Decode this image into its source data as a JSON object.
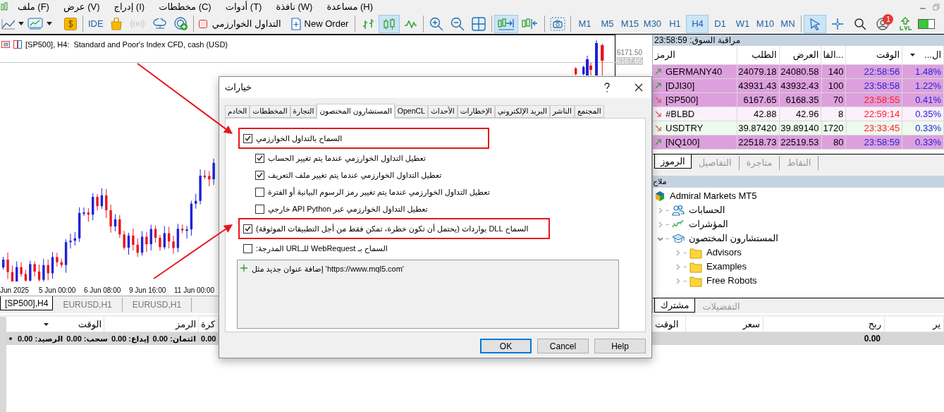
{
  "menu": [
    {
      "label": "مساعدة (H)"
    },
    {
      "label": "نافذة (W)"
    },
    {
      "label": "أدوات (T)"
    },
    {
      "label": "مخططات (C)"
    },
    {
      "label": "إدراج (I)"
    },
    {
      "label": "عرض (V)"
    },
    {
      "label": "ملف (F)"
    }
  ],
  "toolbar": {
    "ide": "IDE",
    "algo_trading": "التداول الخوارزمي",
    "new_order": "New Order",
    "chart_modes": [
      {
        "kind": "line",
        "selected": false
      },
      {
        "kind": "candles",
        "selected": true
      },
      {
        "kind": "bars",
        "selected": false
      }
    ],
    "scroll_modes": [
      {
        "kind": "shift",
        "selected": false
      },
      {
        "kind": "autoscroll",
        "selected": true
      }
    ],
    "timeframes": [
      {
        "label": "MN",
        "selected": false
      },
      {
        "label": "M10",
        "selected": false
      },
      {
        "label": "W1",
        "selected": false
      },
      {
        "label": "D1",
        "selected": false
      },
      {
        "label": "H4",
        "selected": true
      },
      {
        "label": "H1",
        "selected": false
      },
      {
        "label": "M30",
        "selected": false
      },
      {
        "label": "M15",
        "selected": false
      },
      {
        "label": "M5",
        "selected": false
      },
      {
        "label": "M1",
        "selected": false
      }
    ],
    "pointer_tools": [
      {
        "kind": "crosshair",
        "selected": false
      },
      {
        "kind": "cursor",
        "selected": true
      }
    ],
    "notification_count": "1"
  },
  "chart": {
    "title": "[SP500], H4:  Standard and Poor's Index CFD, cash (USD)",
    "price_labels": [
      {
        "label": "6171.50",
        "selected": false
      },
      {
        "label": "6167.65",
        "selected": true
      }
    ],
    "x_labels": [
      "11 Jun 00:00",
      "9 Jun 16:00",
      "6 Jun 08:00",
      "5 Jun 00:00",
      "Jun 2025"
    ],
    "tabs": [
      {
        "label": "EURUSD,H1",
        "selected": false
      },
      {
        "label": "EURUSD,H1",
        "selected": false
      },
      {
        "label": "[SP500],H4",
        "selected": true
      }
    ]
  },
  "market_watch": {
    "title": "مراقبة السوق: 23:58:59",
    "columns": [
      "...ال",
      "الوقت",
      "الفا...",
      "العرض",
      "الطلب",
      "الرمز"
    ],
    "rows": [
      {
        "symbol": "GERMANY40",
        "bid": "24079.18",
        "ask": "24080.58",
        "spread": "140",
        "time": "22:58:56",
        "change": "1.48%",
        "rising": true,
        "color": "#dda0dd"
      },
      {
        "symbol": "[DJI30]",
        "bid": "43931.43",
        "ask": "43932.43",
        "spread": "100",
        "time": "23:58:58",
        "change": "1.22%",
        "rising": true,
        "color": "#dda0dd"
      },
      {
        "symbol": "[SP500]",
        "bid": "6167.65",
        "ask": "6168.35",
        "spread": "70",
        "time": "23:58:55",
        "change": "0.41%",
        "rising": false,
        "color": "#dda0dd"
      },
      {
        "symbol": "#BLBD",
        "bid": "42.88",
        "ask": "42.96",
        "spread": "8",
        "time": "22:59:14",
        "change": "0.35%",
        "rising": false,
        "color": "#fcf0fc"
      },
      {
        "symbol": "USDTRY",
        "bid": "39.87420",
        "ask": "39.89140",
        "spread": "1720",
        "time": "23:33:45",
        "change": "0.33%",
        "rising": false,
        "color": "#eefaee"
      },
      {
        "symbol": "[NQ100]",
        "bid": "22518.73",
        "ask": "22519.53",
        "spread": "80",
        "time": "23:58:59",
        "change": "0.33%",
        "rising": true,
        "color": "#dda0dd"
      }
    ],
    "tabs": [
      {
        "label": "النقاط",
        "selected": false
      },
      {
        "label": "متاجرة",
        "selected": false
      },
      {
        "label": "التفاصيل",
        "selected": false
      },
      {
        "label": "الرموز",
        "selected": true
      }
    ]
  },
  "navigator": {
    "title": "ملاح",
    "root": {
      "label": "Admiral Markets MT5",
      "children": [
        {
          "label": "الحسابات",
          "kind": "accounts",
          "expanded": false
        },
        {
          "label": "المؤشرات",
          "kind": "indicators",
          "expanded": false
        },
        {
          "label": "المستشارون المختصون",
          "kind": "experts",
          "expanded": true,
          "children": [
            {
              "label": "Advisors",
              "kind": "folder",
              "expanded": false
            },
            {
              "label": "Examples",
              "kind": "folder",
              "expanded": false
            },
            {
              "label": "Free Robots",
              "kind": "folder",
              "expanded": false
            }
          ]
        }
      ]
    },
    "tabs": [
      {
        "label": "التفضيلات",
        "selected": false
      },
      {
        "label": "مشترك",
        "selected": true
      }
    ]
  },
  "toolbox": {
    "columns": [
      {
        "label": "كرة",
        "sorted": false
      },
      {
        "label": "الرمز",
        "sorted": false
      },
      {
        "label": "الوقت",
        "sorted": true
      }
    ],
    "summary": [
      "0.00",
      "ائتمان: 0.00",
      "إيداع: 0.00",
      "سحب: 0.00",
      "الرصيد: 0.00"
    ],
    "right_columns": [
      "ير",
      "ربح",
      "سعر",
      "الوقت"
    ],
    "profit_total": "0.00"
  },
  "dialog": {
    "title": "خيارات",
    "tabs": [
      {
        "label": "المجتمع",
        "selected": false
      },
      {
        "label": "الناشر",
        "selected": false
      },
      {
        "label": "البريد الإلكتروني",
        "selected": false
      },
      {
        "label": "الإخطارات",
        "selected": false
      },
      {
        "label": "الأحداث",
        "selected": false
      },
      {
        "label": "OpenCL",
        "selected": false
      },
      {
        "label": "المستشارون المختصون",
        "selected": true
      },
      {
        "label": "التجارة",
        "selected": false
      },
      {
        "label": "المخططات",
        "selected": false
      },
      {
        "label": "الخادم",
        "selected": false
      }
    ],
    "options": [
      {
        "label": "السماح بالتداول الخوارزمي",
        "checked": true,
        "highlighted": true,
        "children": [
          {
            "label": "تعطيل التداول الخوارزمي عندما يتم تغيير الحساب",
            "checked": true,
            "highlighted": false
          },
          {
            "label": "تعطيل التداول الخوارزمي عندما يتم تغيير ملف التعريف",
            "checked": true,
            "highlighted": false
          },
          {
            "label": "تعطيل التداول الخوارزمي عندما يتم تغيير رمز الرسوم البيانية أو الفترة",
            "checked": false,
            "highlighted": false
          },
          {
            "label": "تعطيل التداول الخوارزمي عبر API Python خارجي",
            "checked": false,
            "highlighted": false
          }
        ]
      },
      {
        "label": "السماح DLL بواردات (يحتمل أن تكون خطرة، تمكن فقط من أجل التطبيقات الموثوقة)",
        "checked": true,
        "highlighted": true
      },
      {
        "label": "السماح بـ WebRequest للـURL المدرجة:",
        "checked": false,
        "highlighted": false
      }
    ],
    "url_hint": "إضافة عنوان جديد مثل 'https://www.mql5.com'",
    "buttons": [
      {
        "label": "Help",
        "default": false
      },
      {
        "label": "Cancel",
        "default": false
      },
      {
        "label": "OK",
        "default": true
      }
    ]
  }
}
